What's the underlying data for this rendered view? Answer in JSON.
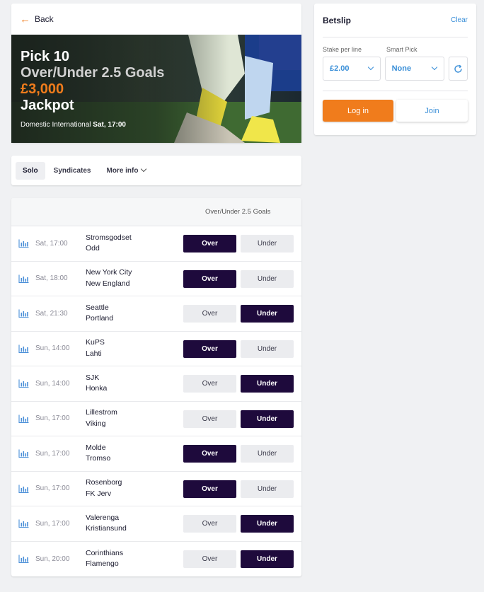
{
  "back_label": "Back",
  "hero": {
    "line1": "Pick 10",
    "line2": "Over/Under 2.5 Goals",
    "line3": "£3,000",
    "line4": "Jackpot",
    "competition": "Domestic International",
    "start": "Sat, 17:00"
  },
  "tabs": {
    "solo": "Solo",
    "syndicates": "Syndicates",
    "more_info": "More info"
  },
  "table_header": "Over/Under 2.5 Goals",
  "options": {
    "over": "Over",
    "under": "Under"
  },
  "matches": [
    {
      "time": "Sat, 17:00",
      "home": "Stromsgodset",
      "away": "Odd",
      "selected": "over"
    },
    {
      "time": "Sat, 18:00",
      "home": "New York City",
      "away": "New England",
      "selected": "over"
    },
    {
      "time": "Sat, 21:30",
      "home": "Seattle",
      "away": "Portland",
      "selected": "under"
    },
    {
      "time": "Sun, 14:00",
      "home": "KuPS",
      "away": "Lahti",
      "selected": "over"
    },
    {
      "time": "Sun, 14:00",
      "home": "SJK",
      "away": "Honka",
      "selected": "under"
    },
    {
      "time": "Sun, 17:00",
      "home": "Lillestrom",
      "away": "Viking",
      "selected": "under"
    },
    {
      "time": "Sun, 17:00",
      "home": "Molde",
      "away": "Tromso",
      "selected": "over"
    },
    {
      "time": "Sun, 17:00",
      "home": "Rosenborg",
      "away": "FK Jerv",
      "selected": "over"
    },
    {
      "time": "Sun, 17:00",
      "home": "Valerenga",
      "away": "Kristiansund",
      "selected": "under"
    },
    {
      "time": "Sun, 20:00",
      "home": "Corinthians",
      "away": "Flamengo",
      "selected": "under"
    }
  ],
  "betslip": {
    "title": "Betslip",
    "clear": "Clear",
    "stake_label": "Stake per line",
    "stake_value": "£2.00",
    "smart_label": "Smart Pick",
    "smart_value": "None",
    "login": "Log in",
    "join": "Join"
  },
  "colors": {
    "accent": "#f07c1c",
    "selected": "#1e0a3c",
    "link": "#3a8fd8"
  },
  "icons": [
    "back-arrow-icon",
    "chevron-down-icon",
    "stats-icon",
    "refresh-icon"
  ]
}
